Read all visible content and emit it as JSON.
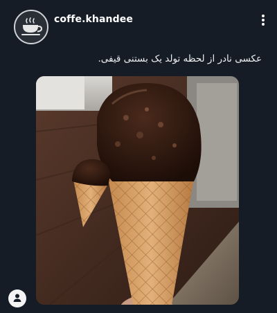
{
  "post": {
    "username": "coffe.khandee",
    "caption": "عکسی نادر از لحظه تولد یک بستنی قیفی.",
    "avatar_icon": "coffee-cup-icon",
    "more_icon": "more-vertical-icon",
    "tag_icon": "user-tag-icon"
  },
  "colors": {
    "background": "#161c26",
    "text": "#ffffff"
  }
}
